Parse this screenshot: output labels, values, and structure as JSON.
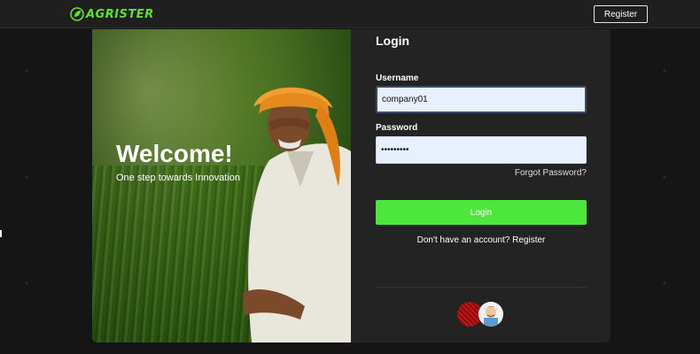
{
  "header": {
    "logo_text": "AGRISTER",
    "register_label": "Register"
  },
  "hero": {
    "title": "Welcome!",
    "subtitle": "One step towards Innovation"
  },
  "form": {
    "title": "Login",
    "username_label": "Username",
    "username_value": "company01",
    "password_label": "Password",
    "password_value": "•••••••••",
    "forgot_label": "Forgot Password?",
    "login_label": "Login",
    "signup_prompt": "Don't have an account?",
    "signup_link": "Register"
  },
  "colors": {
    "accent": "#4ce63c",
    "logo": "#5fe02b",
    "background": "#151515",
    "card": "#232323",
    "input_bg": "#e8f0fe"
  },
  "icons": [
    "leaf-logo-icon",
    "red-avatar-icon",
    "farmer-avatar-icon"
  ]
}
